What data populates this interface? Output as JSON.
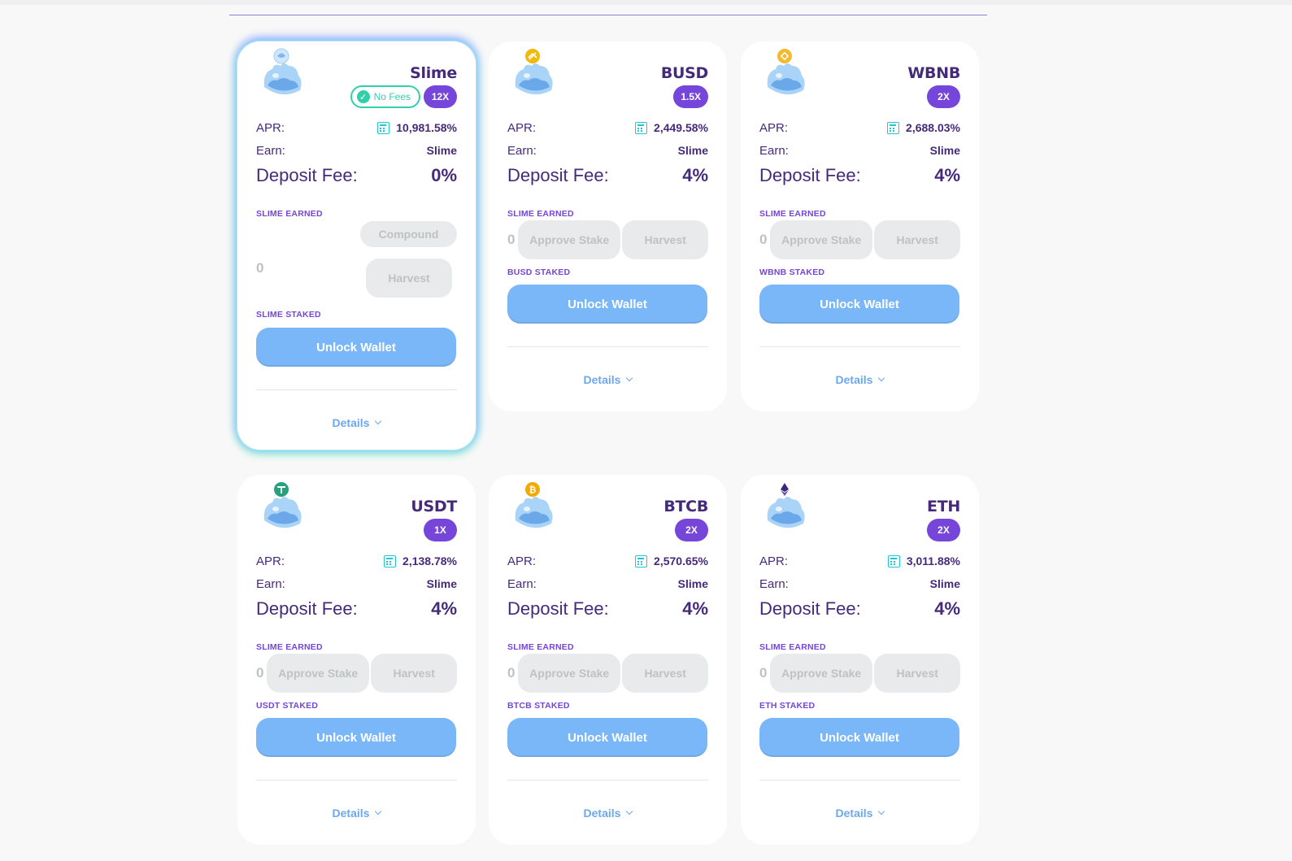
{
  "colors": {
    "text_primary": "#452a7a",
    "accent_purple": "#7645d9",
    "teal": "#31d0aa",
    "unlock_blue": "#7ab7f8",
    "details_blue": "#6ca8f0",
    "disabled_grey": "#e9eaeb"
  },
  "labels": {
    "apr": "APR:",
    "earn": "Earn:",
    "deposit_fee": "Deposit Fee:",
    "slime_earned_prefix": "SLIME",
    "earned_suffix": "EARNED",
    "staked_suffix": "STAKED",
    "compound": "Compound",
    "harvest": "Harvest",
    "approve_stake": "Approve Stake",
    "unlock_wallet": "Unlock Wallet",
    "details": "Details",
    "no_fees": "No Fees",
    "earned_amount": "0"
  },
  "farms": [
    {
      "name": "Slime",
      "multiplier": "12X",
      "apr": "10,981.58%",
      "earn": "Slime",
      "deposit_fee": "0%",
      "staked_token": "SLIME",
      "no_fees": true,
      "coin_icon": "slime-coin-icon",
      "coin_color": "#9ad0f5"
    },
    {
      "name": "BUSD",
      "multiplier": "1.5X",
      "apr": "2,449.58%",
      "earn": "Slime",
      "deposit_fee": "4%",
      "staked_token": "BUSD",
      "coin_icon": "busd-coin-icon",
      "coin_color": "#f0b90b"
    },
    {
      "name": "WBNB",
      "multiplier": "2X",
      "apr": "2,688.03%",
      "earn": "Slime",
      "deposit_fee": "4%",
      "staked_token": "WBNB",
      "coin_icon": "bnb-coin-icon",
      "coin_color": "#f3ba2f"
    },
    {
      "name": "USDT",
      "multiplier": "1X",
      "apr": "2,138.78%",
      "earn": "Slime",
      "deposit_fee": "4%",
      "staked_token": "USDT",
      "coin_icon": "tether-coin-icon",
      "coin_color": "#26a17b"
    },
    {
      "name": "BTCB",
      "multiplier": "2X",
      "apr": "2,570.65%",
      "earn": "Slime",
      "deposit_fee": "4%",
      "staked_token": "BTCB",
      "coin_icon": "bitcoin-coin-icon",
      "coin_color": "#f2a900"
    },
    {
      "name": "ETH",
      "multiplier": "2X",
      "apr": "3,011.88%",
      "earn": "Slime",
      "deposit_fee": "4%",
      "staked_token": "ETH",
      "coin_icon": "ethereum-coin-icon",
      "coin_color": "#ffffff"
    }
  ]
}
